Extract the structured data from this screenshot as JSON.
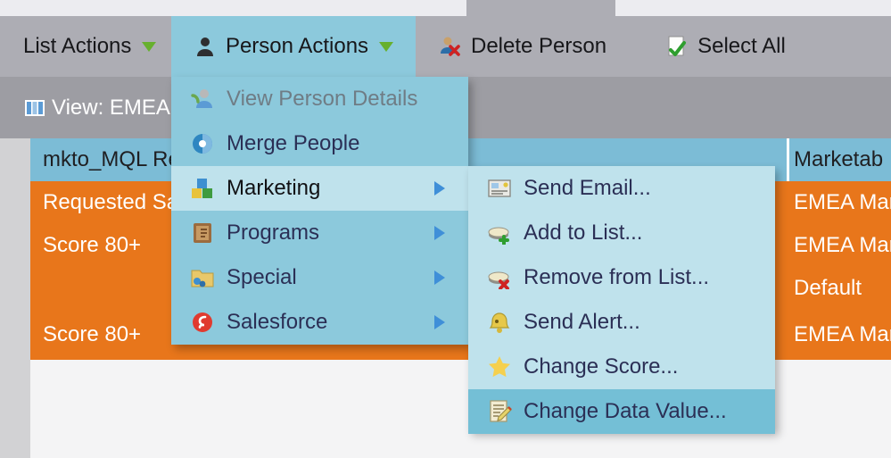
{
  "window": {
    "tab_strip_active_tab": ""
  },
  "toolbar": {
    "items": [
      {
        "label": "List Actions",
        "icon": "",
        "has_caret": true,
        "active": false
      },
      {
        "label": "Person Actions",
        "icon": "person-icon",
        "has_caret": true,
        "active": true
      },
      {
        "label": "Delete Person",
        "icon": "person-delete-icon",
        "has_caret": false,
        "active": false
      },
      {
        "label": "Select All",
        "icon": "checked-document-icon",
        "has_caret": false,
        "active": false
      }
    ]
  },
  "view_bar": {
    "icon": "grid-columns-icon",
    "label": "View: EMEA M"
  },
  "grid": {
    "rows": [
      {
        "left": "mkto_MQL Re",
        "right": "Marketab",
        "state": "selected"
      },
      {
        "left": "Requested Sa",
        "right": "EMEA Mar",
        "state": "orange"
      },
      {
        "left": "Score 80+",
        "right": "EMEA Mar",
        "state": "orange"
      },
      {
        "left": "",
        "right": "Default",
        "state": "orange"
      },
      {
        "left": "Score 80+",
        "right": "EMEA Mar",
        "state": "orange"
      }
    ]
  },
  "person_actions_menu": {
    "name": "Person Actions",
    "items": [
      {
        "label": "View Person Details",
        "icon": "person-view-icon",
        "disabled": true,
        "submenu": false,
        "highlight": "none"
      },
      {
        "label": "Merge People",
        "icon": "merge-people-icon",
        "disabled": false,
        "submenu": false,
        "highlight": "none"
      },
      {
        "label": "Marketing",
        "icon": "marketing-blocks-icon",
        "disabled": false,
        "submenu": true,
        "highlight": "light"
      },
      {
        "label": "Programs",
        "icon": "programs-icon",
        "disabled": false,
        "submenu": true,
        "highlight": "none"
      },
      {
        "label": "Special",
        "icon": "special-folder-icon",
        "disabled": false,
        "submenu": true,
        "highlight": "none"
      },
      {
        "label": "Salesforce",
        "icon": "salesforce-cloud-icon",
        "disabled": false,
        "submenu": true,
        "highlight": "none"
      }
    ]
  },
  "marketing_submenu": {
    "name": "Marketing",
    "items": [
      {
        "label": "Send Email...",
        "icon": "email-card-icon",
        "highlight": "none"
      },
      {
        "label": "Add to List...",
        "icon": "list-add-icon",
        "highlight": "none"
      },
      {
        "label": "Remove from List...",
        "icon": "list-remove-icon",
        "highlight": "none"
      },
      {
        "label": "Send Alert...",
        "icon": "alert-bell-icon",
        "highlight": "none"
      },
      {
        "label": "Change Score...",
        "icon": "star-icon",
        "highlight": "none"
      },
      {
        "label": "Change Data Value...",
        "icon": "edit-document-icon",
        "highlight": "strong"
      }
    ]
  },
  "colors": {
    "toolbar_gray": "#adadb4",
    "viewbar_gray": "#9d9da3",
    "menu_blue": "#8cc9dc",
    "submenu_blue": "#bfe2ec",
    "highlight_blue": "#74bfd6",
    "row_orange": "#e8761b",
    "row_selected": "#7cbcd6",
    "caret_green": "#67b02e",
    "arrow_blue": "#3f8fd8"
  }
}
